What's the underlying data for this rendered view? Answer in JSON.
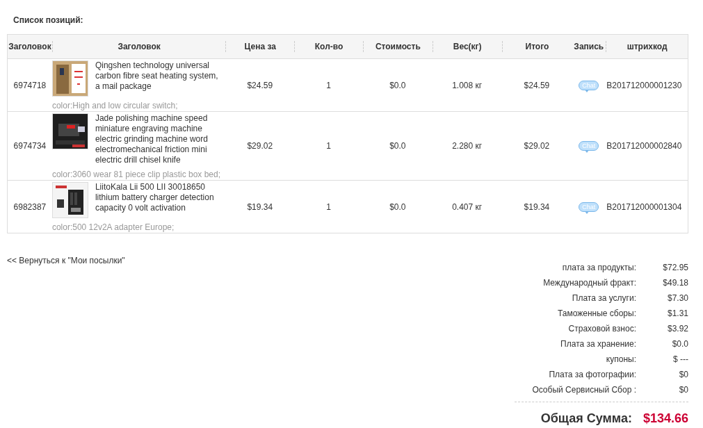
{
  "section_title": "Список позиций:",
  "table": {
    "columns": [
      "Заголовок",
      "Заголовок",
      "Цена за",
      "Кол-во",
      "Стоимость",
      "Вес(кг)",
      "Итого",
      "Запись",
      "штрихкод"
    ],
    "rows": [
      {
        "id": "6974718",
        "title": "Qingshen technology universal carbon fibre seat heating system, a mail package",
        "option": "color:High and low circular switch;",
        "price": "$24.59",
        "qty": "1",
        "cost": "$0.0",
        "weight": "1.008 кг",
        "total": "$24.59",
        "chat": "Chat",
        "barcode": "B201712000001230"
      },
      {
        "id": "6974734",
        "title": "Jade polishing machine speed miniature engraving machine electric grinding machine word electromechanical friction mini electric drill chisel knife",
        "option": "color:3060 wear 81 piece clip plastic box bed;",
        "price": "$29.02",
        "qty": "1",
        "cost": "$0.0",
        "weight": "2.280 кг",
        "total": "$29.02",
        "chat": "Chat",
        "barcode": "B201712000002840"
      },
      {
        "id": "6982387",
        "title": "LiitoKala Lii 500 LII 30018650 lithium battery charger detection capacity 0 volt activation",
        "option": "color:500 12v2A adapter Europe;",
        "price": "$19.34",
        "qty": "1",
        "cost": "$0.0",
        "weight": "0.407 кг",
        "total": "$19.34",
        "chat": "Chat",
        "barcode": "B201712000001304"
      }
    ]
  },
  "back_link": "<< Вернуться к \"Мои посылки\"",
  "fees": [
    {
      "label": "плата за продукты:",
      "value": "$72.95"
    },
    {
      "label": "Международный фракт:",
      "value": "$49.18"
    },
    {
      "label": "Плата за услуги:",
      "value": "$7.30"
    },
    {
      "label": "Таможенные сборы:",
      "value": "$1.31"
    },
    {
      "label": "Страховой взнос:",
      "value": "$3.92"
    },
    {
      "label": "Плата за хранение:",
      "value": "$0.0"
    },
    {
      "label": "купоны:",
      "value": "$ ---"
    },
    {
      "label": "Плата за фотографии:",
      "value": "$0"
    },
    {
      "label": "Особый Сервисный Сбор :",
      "value": "$0"
    }
  ],
  "grand_total": {
    "label": "Общая Сумма:",
    "value": "$134.66"
  }
}
